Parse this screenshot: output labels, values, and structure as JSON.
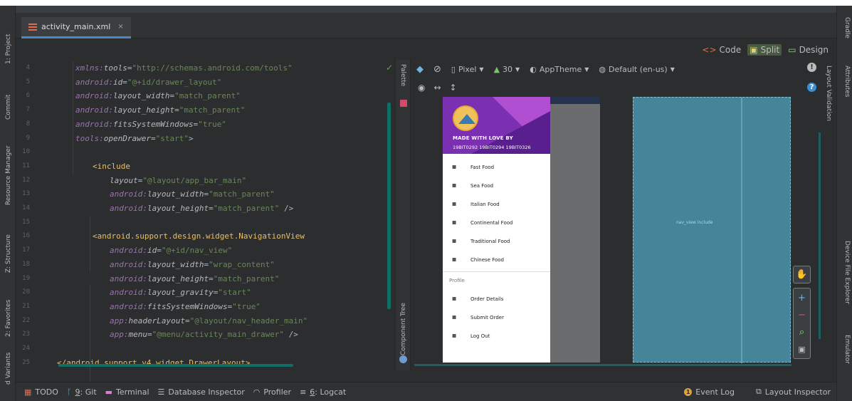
{
  "left_tabs": [
    {
      "label": "1: Project",
      "icon": "project-icon"
    },
    {
      "label": "Commit",
      "icon": "commit-icon"
    },
    {
      "label": "Resource Manager",
      "icon": "resource-icon"
    },
    {
      "label": "Z: Structure",
      "icon": "structure-icon"
    },
    {
      "label": "2: Favorites",
      "icon": "star-icon"
    },
    {
      "label": "d Variants",
      "icon": "variants-icon"
    }
  ],
  "right_tabs": [
    {
      "label": "Gradle"
    },
    {
      "label": "Attributes"
    },
    {
      "label": "Layout Validation"
    },
    {
      "label": "Device File Explorer"
    },
    {
      "label": "Emulator"
    }
  ],
  "file_tab": {
    "name": "activity_main.xml",
    "close": "×"
  },
  "view_modes": {
    "code": "Code",
    "split": "Split",
    "design": "Design"
  },
  "code_lines": [
    {
      "n": "4",
      "parts": [
        [
          "ns",
          "xmlns:"
        ],
        [
          "attr",
          "tools"
        ],
        [
          "plain",
          "="
        ],
        [
          "val",
          "\"http://schemas.android.com/tools\""
        ]
      ]
    },
    {
      "n": "5",
      "parts": [
        [
          "ns",
          "android:"
        ],
        [
          "attr",
          "id"
        ],
        [
          "plain",
          "="
        ],
        [
          "val",
          "\"@+id/drawer_layout\""
        ]
      ]
    },
    {
      "n": "6",
      "parts": [
        [
          "ns",
          "android:"
        ],
        [
          "attr",
          "layout_width"
        ],
        [
          "plain",
          "="
        ],
        [
          "val",
          "\"match_parent\""
        ]
      ]
    },
    {
      "n": "7",
      "parts": [
        [
          "ns",
          "android:"
        ],
        [
          "attr",
          "layout_height"
        ],
        [
          "plain",
          "="
        ],
        [
          "val",
          "\"match_parent\""
        ]
      ]
    },
    {
      "n": "8",
      "parts": [
        [
          "ns",
          "android:"
        ],
        [
          "attr",
          "fitsSystemWindows"
        ],
        [
          "plain",
          "="
        ],
        [
          "val",
          "\"true\""
        ]
      ]
    },
    {
      "n": "9",
      "parts": [
        [
          "ns",
          "tools:"
        ],
        [
          "attr",
          "openDrawer"
        ],
        [
          "plain",
          "="
        ],
        [
          "val",
          "\"start\""
        ],
        [
          "plain",
          ">"
        ]
      ]
    },
    {
      "n": "10",
      "parts": []
    },
    {
      "n": "11",
      "indent": 1,
      "parts": [
        [
          "tag",
          "<include"
        ]
      ]
    },
    {
      "n": "12",
      "indent": 2,
      "parts": [
        [
          "attr",
          "layout"
        ],
        [
          "plain",
          "="
        ],
        [
          "val",
          "\"@layout/app_bar_main\""
        ]
      ]
    },
    {
      "n": "13",
      "indent": 2,
      "parts": [
        [
          "ns",
          "android:"
        ],
        [
          "attr",
          "layout_width"
        ],
        [
          "plain",
          "="
        ],
        [
          "val",
          "\"match_parent\""
        ]
      ]
    },
    {
      "n": "14",
      "indent": 2,
      "parts": [
        [
          "ns",
          "android:"
        ],
        [
          "attr",
          "layout_height"
        ],
        [
          "plain",
          "="
        ],
        [
          "val",
          "\"match_parent\""
        ],
        [
          "plain",
          " />"
        ]
      ]
    },
    {
      "n": "15",
      "parts": []
    },
    {
      "n": "16",
      "indent": 1,
      "parts": [
        [
          "tag",
          "<android.support.design.widget.NavigationView"
        ]
      ]
    },
    {
      "n": "17",
      "indent": 2,
      "parts": [
        [
          "ns",
          "android:"
        ],
        [
          "attr",
          "id"
        ],
        [
          "plain",
          "="
        ],
        [
          "val",
          "\"@+id/nav_view\""
        ]
      ]
    },
    {
      "n": "18",
      "indent": 2,
      "parts": [
        [
          "ns",
          "android:"
        ],
        [
          "attr",
          "layout_width"
        ],
        [
          "plain",
          "="
        ],
        [
          "val",
          "\"wrap_content\""
        ]
      ]
    },
    {
      "n": "19",
      "indent": 2,
      "parts": [
        [
          "ns",
          "android:"
        ],
        [
          "attr",
          "layout_height"
        ],
        [
          "plain",
          "="
        ],
        [
          "val",
          "\"match_parent\""
        ]
      ]
    },
    {
      "n": "20",
      "indent": 2,
      "parts": [
        [
          "ns",
          "android:"
        ],
        [
          "attr",
          "layout_gravity"
        ],
        [
          "plain",
          "="
        ],
        [
          "val",
          "\"start\""
        ]
      ]
    },
    {
      "n": "21",
      "indent": 2,
      "parts": [
        [
          "ns",
          "android:"
        ],
        [
          "attr",
          "fitsSystemWindows"
        ],
        [
          "plain",
          "="
        ],
        [
          "val",
          "\"true\""
        ]
      ]
    },
    {
      "n": "22",
      "indent": 2,
      "parts": [
        [
          "ns",
          "app:"
        ],
        [
          "attr",
          "headerLayout"
        ],
        [
          "plain",
          "="
        ],
        [
          "val",
          "\"@layout/nav_header_main\""
        ]
      ]
    },
    {
      "n": "23",
      "indent": 2,
      "parts": [
        [
          "ns",
          "app:"
        ],
        [
          "attr",
          "menu"
        ],
        [
          "plain",
          "="
        ],
        [
          "val",
          "\"@menu/activity_main_drawer\""
        ],
        [
          "plain",
          " />"
        ]
      ]
    },
    {
      "n": "24",
      "parts": []
    },
    {
      "n": "25",
      "indent": -1,
      "parts": [
        [
          "tag",
          "</android.support.v4.widget.DrawerLayout>"
        ]
      ]
    }
  ],
  "palette_tab": "Palette",
  "component_tree_tab": "Component Tree",
  "design_toolbar": {
    "device": "Pixel",
    "api": "30",
    "theme": "AppTheme",
    "locale": "Default (en-us)"
  },
  "nav_header": {
    "line1": "MADE WITH LOVE BY",
    "line2": "19BIT0292 19BIT0294 19BIT0326"
  },
  "menu_items": [
    {
      "label": "Fast Food",
      "icon": "burger-icon"
    },
    {
      "label": "Sea Food",
      "icon": "fish-icon"
    },
    {
      "label": "Italian Food",
      "icon": "pizza-icon"
    },
    {
      "label": "Continental Food",
      "icon": "dish-icon"
    },
    {
      "label": "Traditional Food",
      "icon": "bowl-icon"
    },
    {
      "label": "Chinese Food",
      "icon": "noodles-icon"
    }
  ],
  "menu_group_title": "Profile",
  "profile_items": [
    {
      "label": "Order Details",
      "icon": "order-details-icon"
    },
    {
      "label": "Submit Order",
      "icon": "submit-order-icon"
    },
    {
      "label": "Log Out",
      "icon": "logout-icon"
    }
  ],
  "blueprint_label": "nav_view   include",
  "status_bar": {
    "todo": "TODO",
    "git_prefix": "9",
    "git": ": Git",
    "terminal": "Terminal",
    "db": "Database Inspector",
    "profiler": "Profiler",
    "logcat_prefix": "6",
    "logcat": ": Logcat",
    "event_log": "Event Log",
    "layout_inspector": "Layout Inspector"
  },
  "colors": {
    "accent": "#4a88c7",
    "header_purple": "#7b2fb1",
    "blueprint": "#46849a"
  }
}
